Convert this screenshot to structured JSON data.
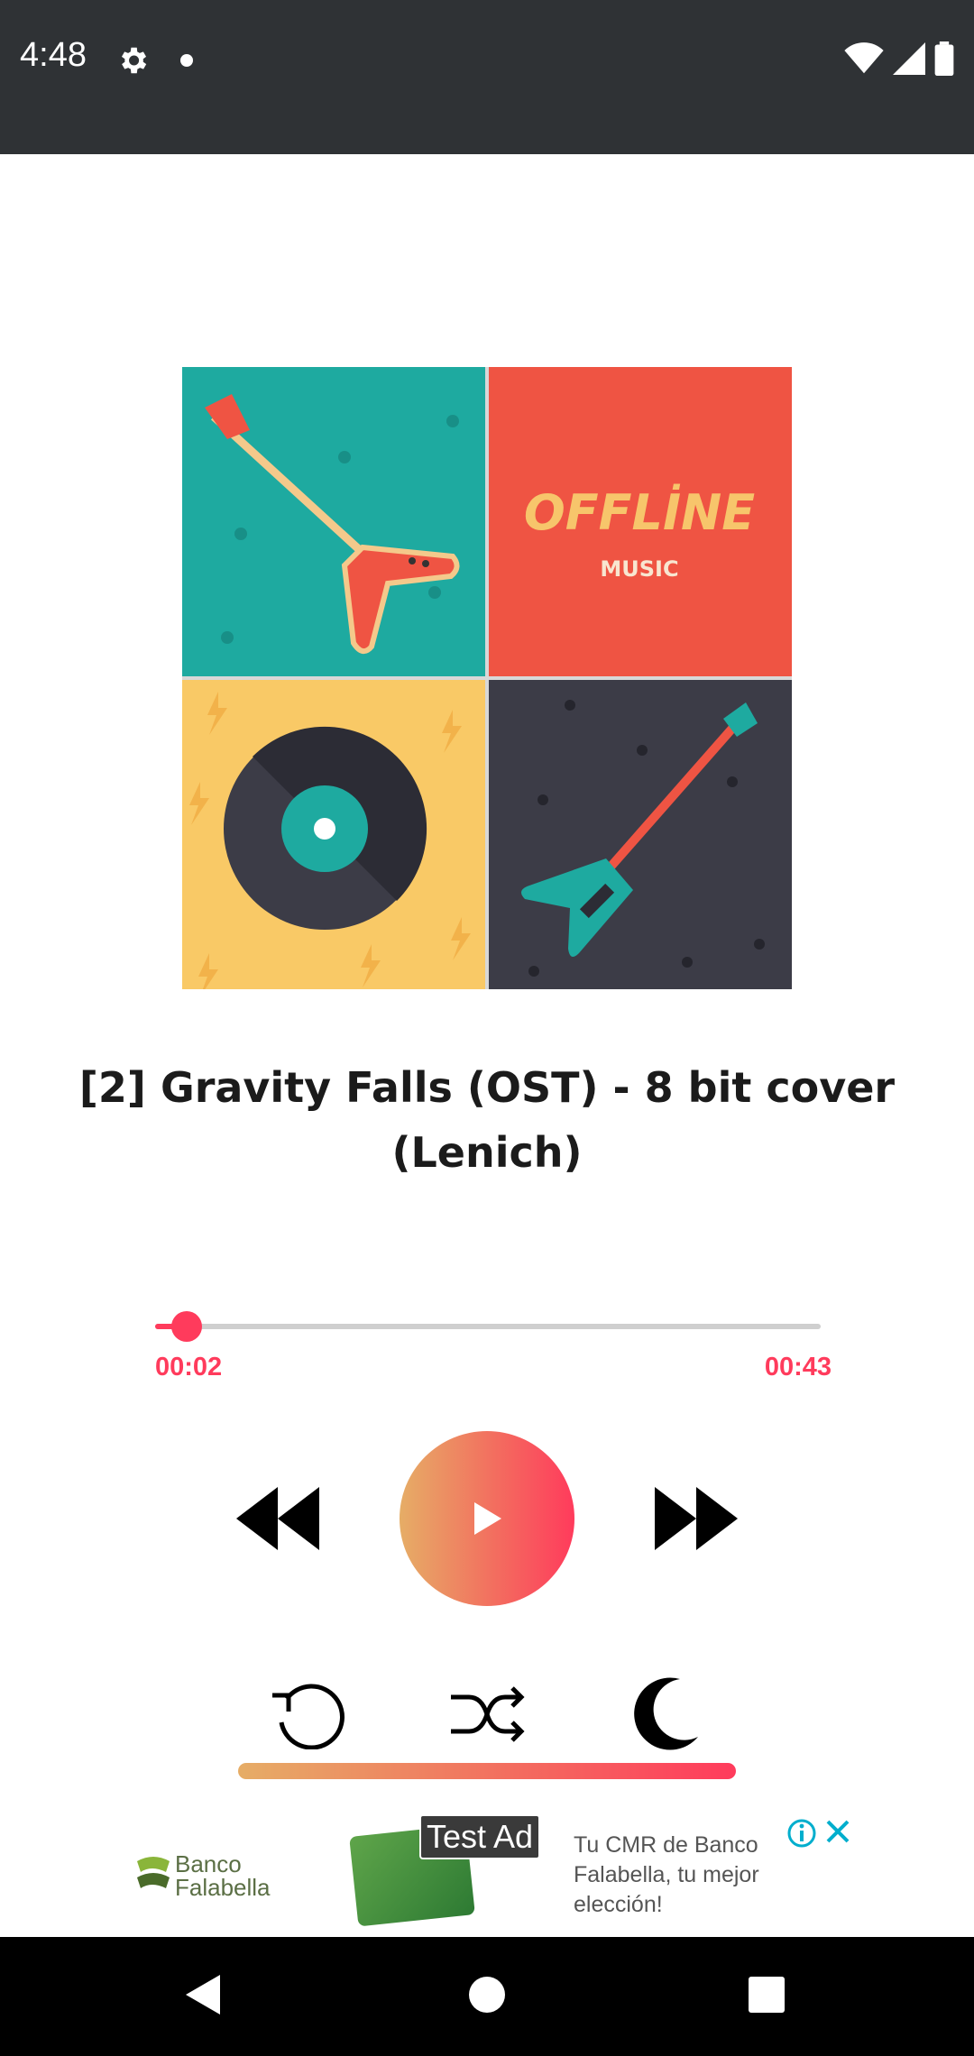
{
  "status_bar": {
    "time": "4:48"
  },
  "player": {
    "album_art": {
      "brand_line1": "OFFLİNE",
      "brand_line2": "MUSIC"
    },
    "title": "[2] Gravity Falls (OST) - 8 bit cover (Lenich)",
    "current_time": "00:02",
    "total_time": "00:43",
    "progress": 0.05
  },
  "ad": {
    "logo_line1": "Banco",
    "logo_line2": "Falabella",
    "label": "Test Ad",
    "text": "Tu CMR de Banco Falabella, tu mejor elección!"
  },
  "colors": {
    "accent": "#ff3b5c",
    "gradient_start": "#e6ad66",
    "status_bar": "#2f3235"
  }
}
